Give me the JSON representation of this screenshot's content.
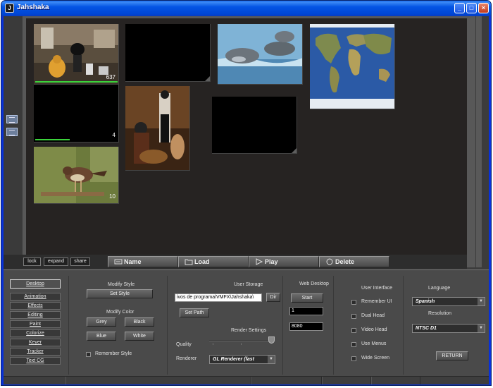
{
  "window": {
    "title": "Jahshaka"
  },
  "desktop": {
    "clips": [
      {
        "thumbnail": "chef-figure-icon",
        "count": "637",
        "progress": 1.0
      },
      {
        "thumbnail": "empty"
      },
      {
        "thumbnail": "dolphins-photo-icon"
      },
      {
        "thumbnail": "world-map-icon"
      },
      {
        "thumbnail": "empty",
        "count": "4",
        "progress": 0.42
      },
      {
        "thumbnail": "dancers-photo-icon"
      },
      {
        "thumbnail": "empty"
      },
      {
        "thumbnail": "bird-photo-icon",
        "count": "10"
      }
    ]
  },
  "toolbar": {
    "lock": "lock",
    "expand": "expand",
    "share": "share",
    "name": "Name",
    "load": "Load",
    "play": "Play",
    "delete": "Delete"
  },
  "nav": {
    "items": [
      "Desktop",
      "Animation",
      "Effects",
      "Editing",
      "Paint",
      "Colorize",
      "Keyer",
      "Tracker",
      "Text CG"
    ],
    "active": "Desktop"
  },
  "style": {
    "modify_style_title": "Modify Style",
    "set_style": "Set Style",
    "modify_color_title": "Modify Color",
    "grey": "Grey",
    "black": "Black",
    "blue": "Blue",
    "white": "White",
    "remember_style": "Remember Style"
  },
  "storage": {
    "title": "User Storage",
    "path_value": "ivos de programa\\VMFX\\Jahshaka\\",
    "dir_button": "Dir",
    "set_path": "Set Path",
    "render_settings": "Render Settings",
    "quality_label": "Quality",
    "renderer_label": "Renderer",
    "renderer_value": "GL Renderer    (fast"
  },
  "web": {
    "title": "Web Desktop",
    "start": "Start",
    "field1": "1",
    "port": "8080"
  },
  "ui": {
    "title": "User Interface",
    "remember_ui": "Remember UI",
    "dual_head": "Dual Head",
    "video_head": "Video Head",
    "use_menus": "Use Menus",
    "wide_screen": "Wide Screen"
  },
  "lang": {
    "title": "Language",
    "language_value": "Spanish",
    "resolution_title": "Resolution",
    "resolution_value": "NTSC D1",
    "return": "RETURN"
  },
  "colors": {
    "title_bar": "#0454e3",
    "desk_bg": "#262322",
    "panel_bg": "#4a4a4a",
    "progress": "#3bd33b"
  }
}
